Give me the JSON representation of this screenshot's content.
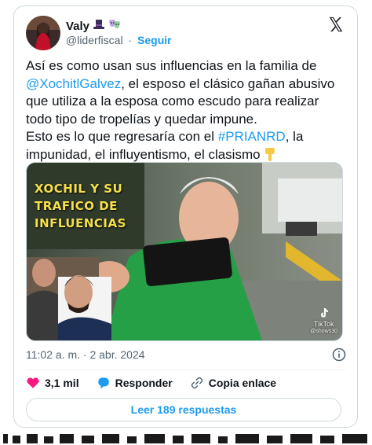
{
  "author": {
    "name": "Valy",
    "handle": "@liderfiscal",
    "follow_label": "Seguir",
    "name_emojis": [
      "top-hat-emoji",
      "theater-masks-emoji"
    ]
  },
  "tweet": {
    "line1": "Así es como usan sus influencias en la familia de",
    "mention": "@XochitlGalvez",
    "line2": ", el esposo el clásico gañan abusivo que utiliza a la esposa como escudo para realizar todo tipo de tropelías y quedar impune.",
    "line3a": "Esto es lo que regresaría con el ",
    "hashtag": "#PRIANRD",
    "line3b": ", la impunidad, el influyentismo, el clasismo",
    "trailing_emoji": "backhand-index-pointing-down-emoji"
  },
  "media": {
    "overlay_title": "XOCHIL Y SU TRAFICO DE INFLUENCIAS",
    "watermark": "TikTok",
    "watermark_user": "@shows30"
  },
  "meta": {
    "time": "11:02 a. m.",
    "separator": "·",
    "date": "2 abr. 2024"
  },
  "actions": {
    "likes": "3,1 mil",
    "reply_label": "Responder",
    "copy_label": "Copia enlace"
  },
  "replies_button": "Leer 189 respuestas",
  "colors": {
    "accent": "#1d9bf0",
    "like": "#f91880",
    "text": "#0f1419",
    "muted": "#536471",
    "border": "#cfd9de"
  }
}
